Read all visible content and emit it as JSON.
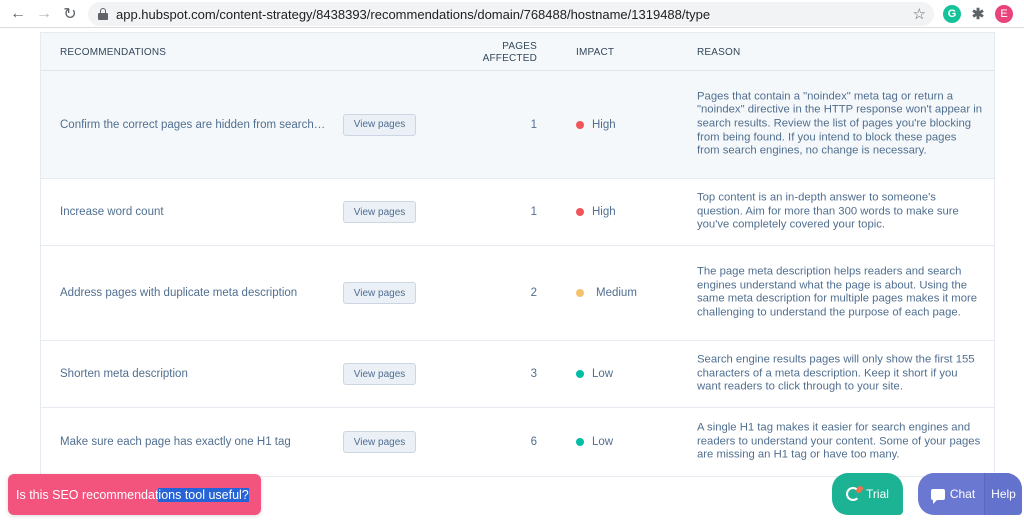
{
  "browser": {
    "url": "app.hubspot.com/content-strategy/8438393/recommendations/domain/768488/hostname/1319488/type",
    "back_icon": "←",
    "forward_icon": "→",
    "reload_icon": "↻",
    "star_icon": "☆",
    "grammarly_label": "G",
    "extensions_icon": "✱",
    "profile_initial": "E"
  },
  "table": {
    "headers": {
      "recommendations": "RECOMMENDATIONS",
      "pages_affected": "PAGES AFFECTED",
      "impact": "IMPACT",
      "reason": "REASON"
    },
    "impact_colors": {
      "High": "#f2545b",
      "Medium": "#f5c26b",
      "Low": "#00bda5"
    },
    "rows": [
      {
        "title": "Confirm the correct pages are hidden from search…",
        "button": "View pages",
        "pages_affected": "1",
        "impact": "High",
        "reason": "Pages that contain a \"noindex\" meta tag or return a \"noindex\" directive in the HTTP response won't appear in search results. Review the list of pages you're blocking from being found. If you intend to block these pages from search engines, no change is necessary."
      },
      {
        "title": "Increase word count",
        "button": "View pages",
        "pages_affected": "1",
        "impact": "High",
        "reason": "Top content is an in-depth answer to someone's question. Aim for more than 300 words to make sure you've completely covered your topic."
      },
      {
        "title": "Address pages with duplicate meta description",
        "button": "View pages",
        "pages_affected": "2",
        "impact": "Medium",
        "reason": "The page meta description helps readers and search engines understand what the page is about. Using the same meta description for multiple pages makes it more challenging to understand the purpose of each page."
      },
      {
        "title": "Shorten meta description",
        "button": "View pages",
        "pages_affected": "3",
        "impact": "Low",
        "reason": "Search engine results pages will only show the first 155 characters of a meta description. Keep it short if you want readers to click through to your site."
      },
      {
        "title": "Make sure each page has exactly one H1 tag",
        "button": "View pages",
        "pages_affected": "6",
        "impact": "Low",
        "reason": "A single H1 tag makes it easier for search engines and readers to understand your content. Some of your pages are missing an H1 tag or have too many."
      }
    ]
  },
  "feedback": {
    "text_unselected": "Is this SEO recommendat",
    "text_selected": "ions tool useful?"
  },
  "widgets": {
    "trial_label": "Trial",
    "chat_label": "Chat",
    "help_label": "Help"
  }
}
